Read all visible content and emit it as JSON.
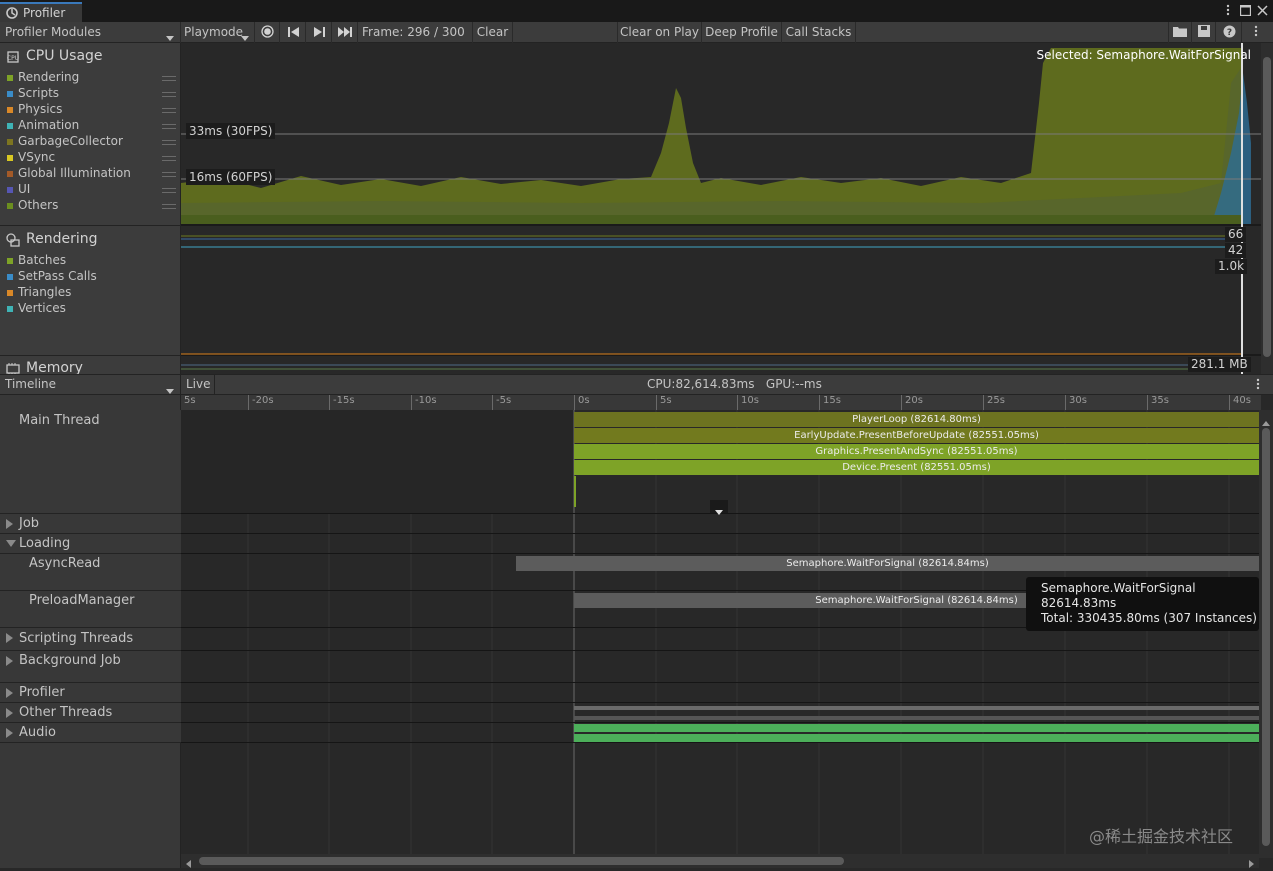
{
  "window": {
    "tab_title": "Profiler"
  },
  "toolbar": {
    "modules_dropdown": "Profiler Modules",
    "playmode_dropdown": "Playmode",
    "frame_label": "Frame: 296 / 300",
    "clear_label": "Clear",
    "clear_on_play_label": "Clear on Play",
    "deep_profile_label": "Deep Profile",
    "call_stacks_label": "Call Stacks"
  },
  "modules": {
    "cpu": {
      "title": "CPU Usage",
      "legend": [
        {
          "label": "Rendering",
          "color": "#7ea327"
        },
        {
          "label": "Scripts",
          "color": "#3a8cc8"
        },
        {
          "label": "Physics",
          "color": "#d98828"
        },
        {
          "label": "Animation",
          "color": "#3fb3b5"
        },
        {
          "label": "GarbageCollector",
          "color": "#7d7520"
        },
        {
          "label": "VSync",
          "color": "#d8c823"
        },
        {
          "label": "Global Illumination",
          "color": "#a35a28"
        },
        {
          "label": "UI",
          "color": "#5656b3"
        },
        {
          "label": "Others",
          "color": "#6b8e1f"
        }
      ],
      "axis_33": "33ms (30FPS)",
      "axis_16": "16ms (60FPS)",
      "selected_label": "Selected: Semaphore.WaitForSignal"
    },
    "rendering": {
      "title": "Rendering",
      "legend": [
        {
          "label": "Batches",
          "color": "#7ea327"
        },
        {
          "label": "SetPass Calls",
          "color": "#3a8cc8"
        },
        {
          "label": "Triangles",
          "color": "#d98828"
        },
        {
          "label": "Vertices",
          "color": "#3fb3b5"
        }
      ],
      "value_1": "66",
      "value_2": "42",
      "value_3": "1.0k"
    },
    "memory": {
      "title": "Memory",
      "value": "281.1 MB"
    }
  },
  "timeline": {
    "view_dropdown": "Timeline",
    "live_label": "Live",
    "cpu_gpu_label": "CPU:82,614.83ms   GPU:--ms",
    "ruler_ticks": [
      "5s",
      "-20s",
      "-15s",
      "-10s",
      "-5s",
      "0s",
      "5s",
      "10s",
      "15s",
      "20s",
      "25s",
      "30s",
      "35s",
      "40s"
    ],
    "threads": {
      "main": "Main Thread",
      "job": "Job",
      "loading": "Loading",
      "asyncread": "AsyncRead",
      "preload": "PreloadManager",
      "scripting": "Scripting Threads",
      "background": "Background Job",
      "profiler": "Profiler",
      "other": "Other Threads",
      "audio": "Audio"
    },
    "markers": {
      "playerloop": "PlayerLoop (82614.80ms)",
      "earlyupdate": "EarlyUpdate.PresentBeforeUpdate (82551.05ms)",
      "graphics": "Graphics.PresentAndSync (82551.05ms)",
      "device": "Device.Present (82551.05ms)",
      "wait_async": "Semaphore.WaitForSignal (82614.84ms)",
      "wait_preload": "Semaphore.WaitForSignal (82614.84ms)"
    },
    "tooltip": {
      "name": "Semaphore.WaitForSignal",
      "duration": "82614.83ms",
      "total": "Total: 330435.80ms (307 Instances)"
    }
  },
  "watermark": "@稀土掘金技术社区",
  "colors": {
    "accent": "#3a79bb",
    "marker_olive": "#6d7a1f",
    "marker_green": "#7ea327",
    "marker_grey": "#5a5a5a",
    "audio_green": "#4caf5a"
  }
}
